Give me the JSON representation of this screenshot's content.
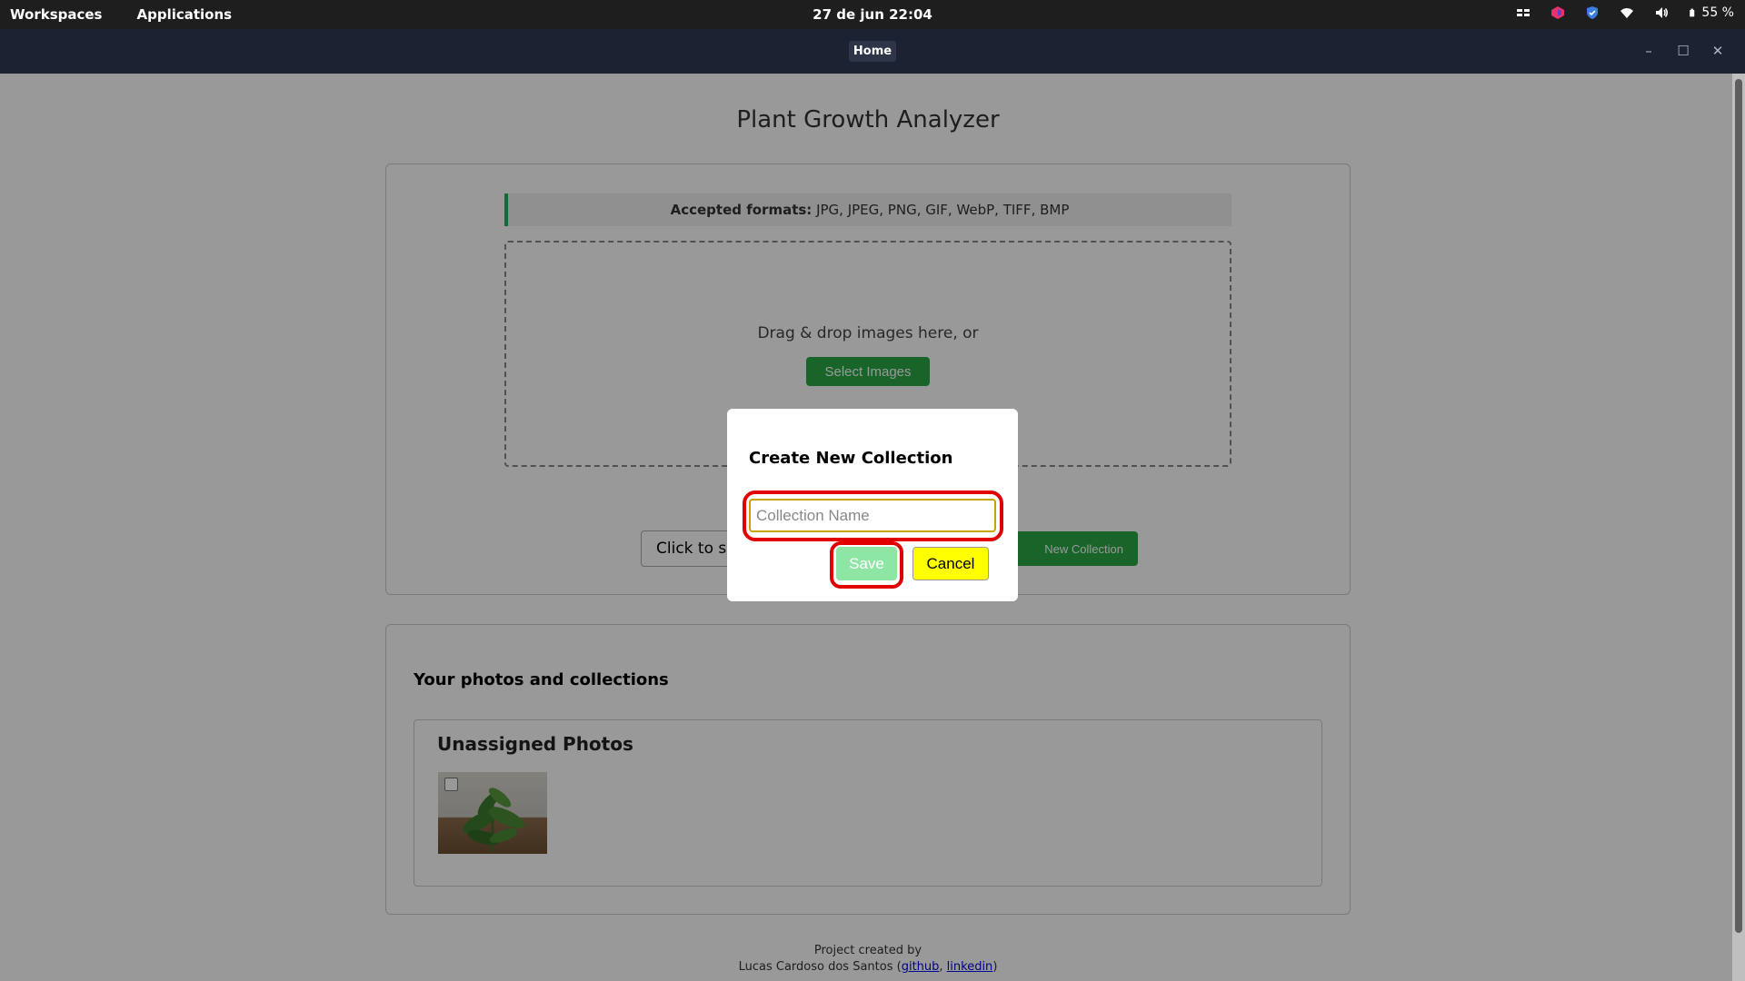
{
  "topbar": {
    "workspaces": "Workspaces",
    "applications": "Applications",
    "clock": "27 de jun  22:04",
    "battery": "55 %"
  },
  "window": {
    "tab_title": "Home",
    "minimize": "–",
    "maximize": "☐",
    "close": "✕"
  },
  "page": {
    "title": "Plant Growth Analyzer",
    "formats_label": "Accepted formats:",
    "formats_value": " JPG, JPEG, PNG, GIF, WebP, TIFF, BMP",
    "drop_hint": "Drag & drop images here, or",
    "select_images": "Select Images",
    "select_files_partial": "Click to sel",
    "new_collection_partial": "New Collection",
    "photos_heading": "Your photos and collections",
    "unassigned_heading": "Unassigned Photos"
  },
  "footer": {
    "line1": "Project created by",
    "author": "Lucas Cardoso dos Santos (",
    "github": "github",
    "sep": ", ",
    "linkedin": "linkedin",
    "close": ")"
  },
  "modal": {
    "title": "Create New Collection",
    "input_placeholder": "Collection Name",
    "input_value": "",
    "save": "Save",
    "cancel": "Cancel"
  }
}
